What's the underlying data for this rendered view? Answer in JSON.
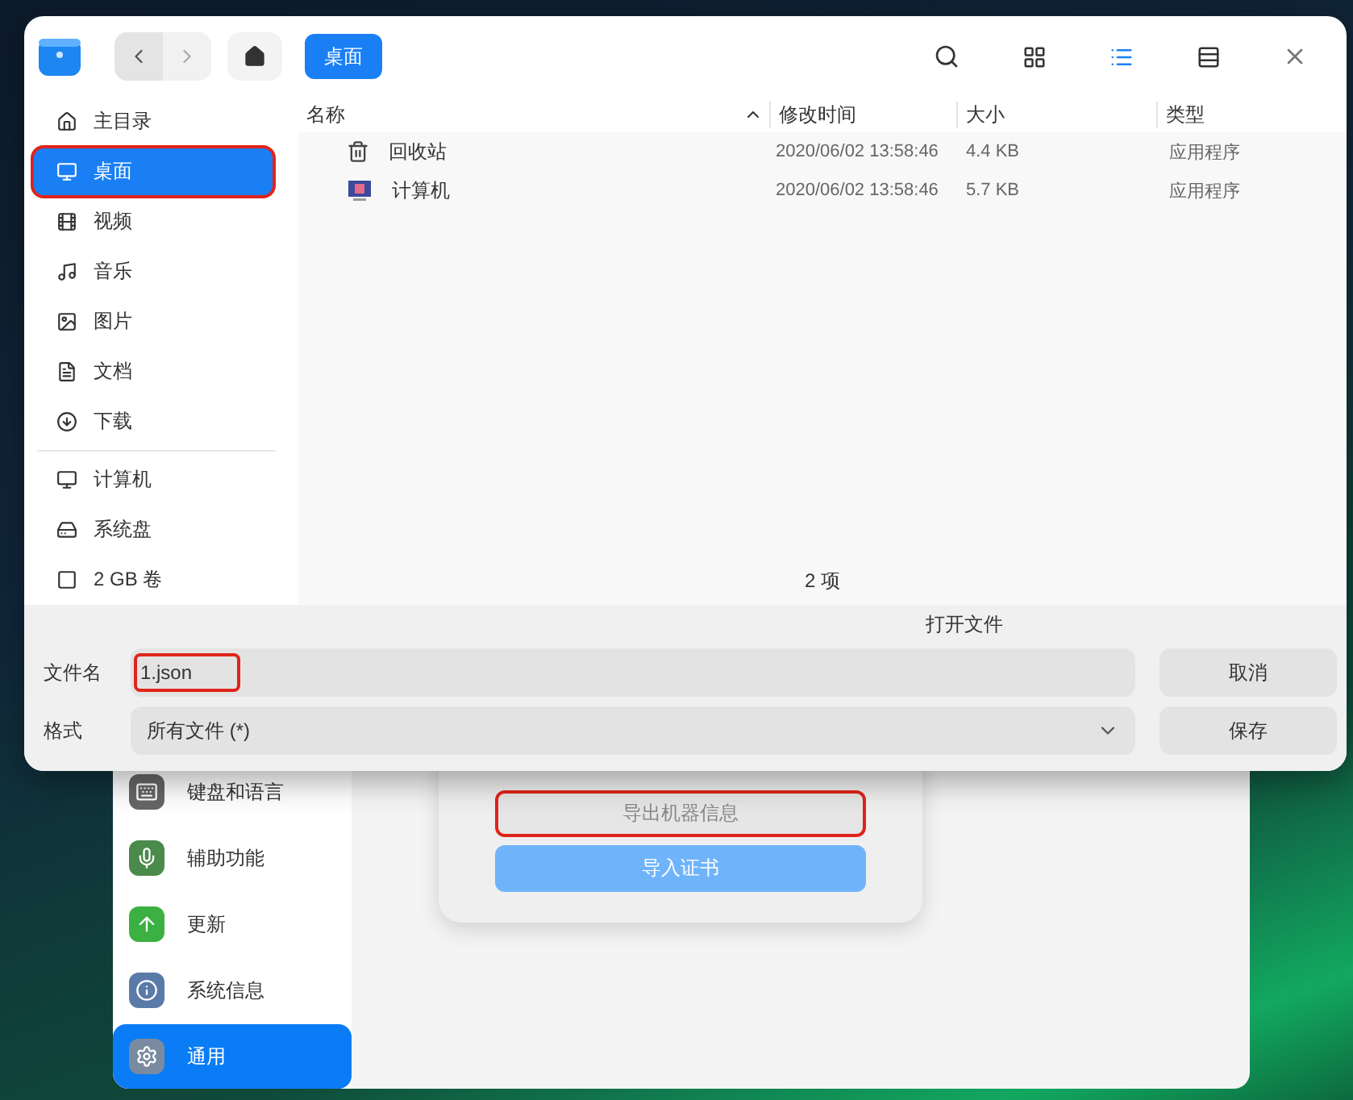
{
  "file_dialog": {
    "breadcrumb": "桌面",
    "view_modes": [
      {
        "selected": false
      },
      {
        "selected": true
      },
      {
        "selected": false
      }
    ],
    "sidebar": {
      "groups": [
        [
          {
            "label": "主目录",
            "selected": false,
            "highlighted": false
          },
          {
            "label": "桌面",
            "selected": true,
            "highlighted": true
          },
          {
            "label": "视频",
            "selected": false,
            "highlighted": false
          },
          {
            "label": "音乐",
            "selected": false,
            "highlighted": false
          },
          {
            "label": "图片",
            "selected": false,
            "highlighted": false
          },
          {
            "label": "文档",
            "selected": false,
            "highlighted": false
          },
          {
            "label": "下载",
            "selected": false,
            "highlighted": false
          }
        ],
        [
          {
            "label": "计算机",
            "selected": false,
            "highlighted": false
          },
          {
            "label": "系统盘",
            "selected": false,
            "highlighted": false
          },
          {
            "label": "2 GB 卷",
            "selected": false,
            "highlighted": false
          }
        ]
      ]
    },
    "columns": [
      {
        "label": "名称",
        "sorted": true
      },
      {
        "label": "修改时间",
        "sorted": false
      },
      {
        "label": "大小",
        "sorted": false
      },
      {
        "label": "类型",
        "sorted": false
      }
    ],
    "rows": [
      {
        "kind": "trash",
        "name": "回收站",
        "modified": "2020/06/02 13:58:46",
        "size": "4.4 KB",
        "type": "应用程序"
      },
      {
        "kind": "computer",
        "name": "计算机",
        "modified": "2020/06/02 13:58:46",
        "size": "5.7 KB",
        "type": "应用程序"
      }
    ],
    "status": "2 项",
    "title": "打开文件",
    "filename": {
      "label": "文件名",
      "value": "1.json",
      "highlighted": true
    },
    "format": {
      "label": "格式",
      "value": "所有文件 (*)"
    },
    "buttons": [
      "取消",
      "保存"
    ]
  },
  "settings": {
    "sidebar": [
      {
        "label": "键盘和语言",
        "selected": false
      },
      {
        "label": "辅助功能",
        "selected": false
      },
      {
        "label": "更新",
        "selected": false
      },
      {
        "label": "系统信息",
        "selected": false
      },
      {
        "label": "通用",
        "selected": true
      }
    ],
    "card_buttons": [
      {
        "label": "导出机器信息",
        "kind": "secondary",
        "highlighted": true
      },
      {
        "label": "导入证书",
        "kind": "primary",
        "highlighted": false
      }
    ]
  }
}
